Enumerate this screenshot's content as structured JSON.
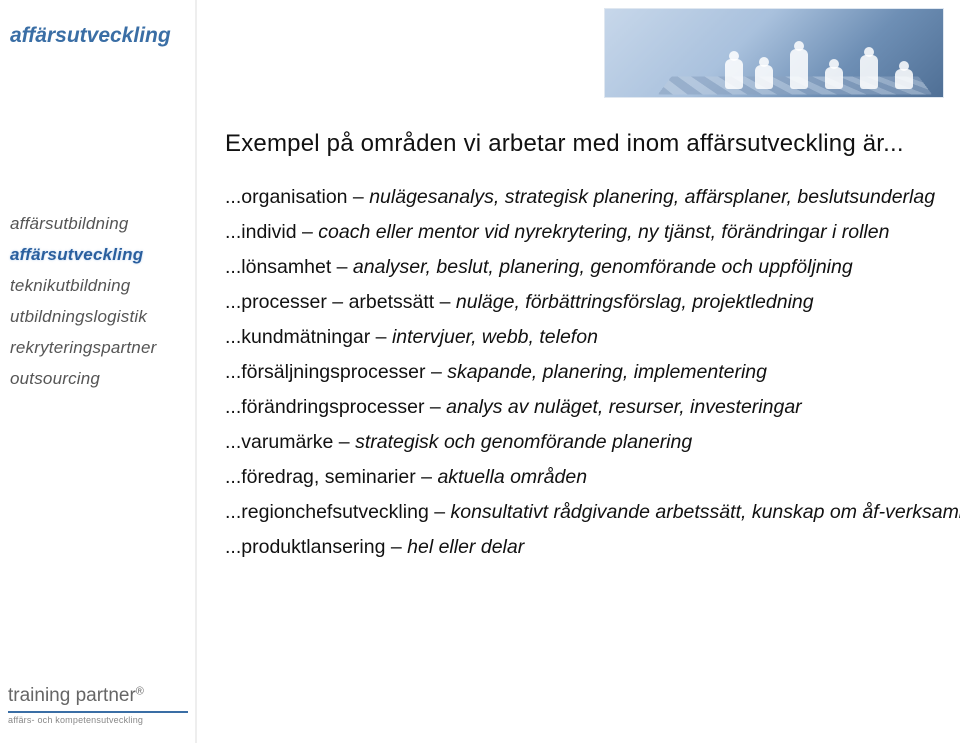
{
  "header": {
    "category": "affärsutveckling"
  },
  "sidebar": {
    "items": [
      {
        "label": "affärsutbildning",
        "active": false
      },
      {
        "label": "affärsutveckling",
        "active": true
      },
      {
        "label": "teknikutbildning",
        "active": false
      },
      {
        "label": "utbildningslogistik",
        "active": false
      },
      {
        "label": "rekryteringspartner",
        "active": false
      },
      {
        "label": "outsourcing",
        "active": false
      }
    ]
  },
  "logo": {
    "brand": "training partner",
    "registered": "®",
    "tagline": "affärs- och kompetensutveckling"
  },
  "hero": {
    "alt": "chess-pieces-photo"
  },
  "content": {
    "title": "Exempel på områden vi arbetar med inom affärsutveckling är...",
    "items": [
      {
        "label": "organisation",
        "desc": "nulägesanalys, strategisk planering, affärsplaner, beslutsunderlag"
      },
      {
        "label": "individ",
        "desc": "coach eller mentor vid nyrekrytering, ny tjänst, förändringar i rollen"
      },
      {
        "label": "lönsamhet",
        "desc": "analyser, beslut, planering, genomförande och uppföljning"
      },
      {
        "label": "processer – arbetssätt",
        "desc": "nuläge, förbättringsförslag, projektledning"
      },
      {
        "label": "kundmätningar",
        "desc": "intervjuer, webb, telefon"
      },
      {
        "label": "försäljningsprocesser",
        "desc": "skapande, planering, implementering"
      },
      {
        "label": "förändringsprocesser",
        "desc": "analys av nuläget, resurser, investeringar"
      },
      {
        "label": "varumärke",
        "desc": "strategisk och genomförande planering"
      },
      {
        "label": "föredrag, seminarier",
        "desc": "aktuella områden"
      },
      {
        "label": "regionchefsutveckling",
        "desc": "konsultativt rådgivande arbetssätt, kunskap om åf-verksamhet"
      },
      {
        "label": "produktlansering",
        "desc": "hel eller delar"
      }
    ],
    "prefix": "...",
    "separator": " – "
  }
}
